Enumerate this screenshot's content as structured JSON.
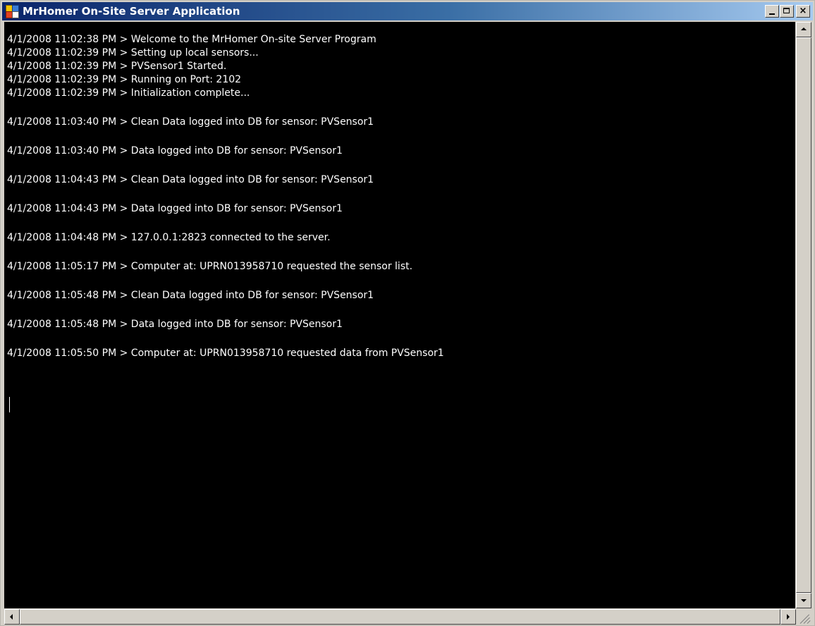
{
  "window": {
    "title": "MrHomer On-Site Server Application",
    "minimize_label": "",
    "maximize_label": "",
    "close_label": "×"
  },
  "console": {
    "background": "#000000",
    "text_color": "#ffffff",
    "lines": [
      "4/1/2008 11:02:38 PM > Welcome to the MrHomer On-site Server Program",
      "4/1/2008 11:02:39 PM > Setting up local sensors...",
      "4/1/2008 11:02:39 PM > PVSensor1 Started.",
      "4/1/2008 11:02:39 PM > Running on Port: 2102",
      "4/1/2008 11:02:39 PM > Initialization complete...",
      "4/1/2008 11:03:40 PM > Clean Data logged into DB for sensor: PVSensor1",
      "4/1/2008 11:03:40 PM > Data logged into DB for sensor: PVSensor1",
      "4/1/2008 11:04:43 PM > Clean Data logged into DB for sensor: PVSensor1",
      "4/1/2008 11:04:43 PM > Data logged into DB for sensor: PVSensor1",
      "4/1/2008 11:04:48 PM > 127.0.0.1:2823 connected to the server.",
      "4/1/2008 11:05:17 PM > Computer at: UPRN013958710 requested the sensor list.",
      "4/1/2008 11:05:48 PM > Clean Data logged into DB for sensor: PVSensor1",
      "4/1/2008 11:05:48 PM > Data logged into DB for sensor: PVSensor1",
      "4/1/2008 11:05:50 PM > Computer at: UPRN013958710 requested data from PVSensor1"
    ]
  },
  "icons": {
    "app": "application-icon",
    "minimize": "minimize-icon",
    "maximize": "maximize-icon",
    "close": "close-icon",
    "scroll_up": "arrow-up-icon",
    "scroll_down": "arrow-down-icon",
    "scroll_left": "arrow-left-icon",
    "scroll_right": "arrow-right-icon"
  }
}
